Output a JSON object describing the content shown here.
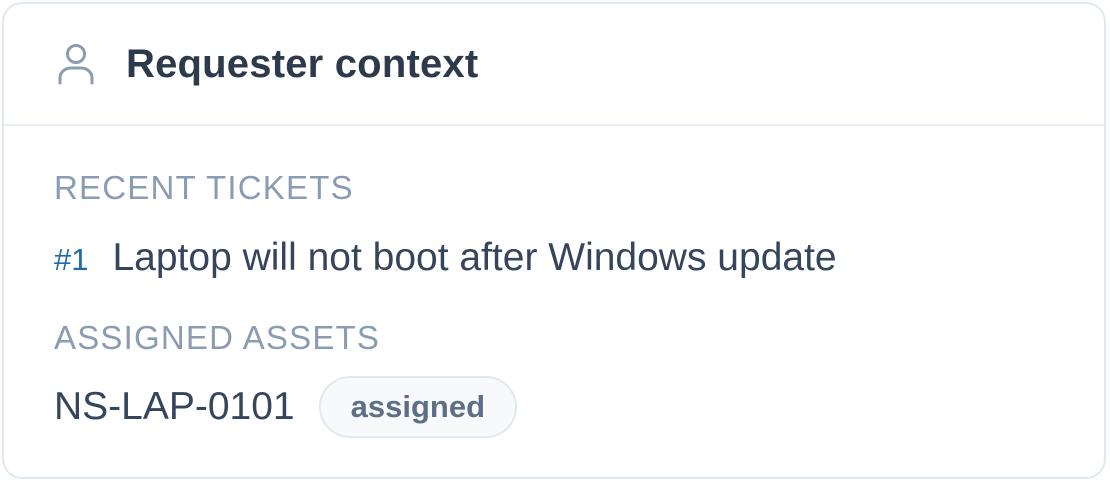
{
  "header": {
    "icon": "user-icon",
    "title": "Requester context"
  },
  "recent_tickets": {
    "label": "RECENT TICKETS",
    "items": [
      {
        "id": "#1",
        "title": "Laptop will not boot after Windows update"
      }
    ]
  },
  "assigned_assets": {
    "label": "ASSIGNED ASSETS",
    "items": [
      {
        "tag": "NS-LAP-0101",
        "status": "assigned"
      }
    ]
  },
  "colors": {
    "title": "#2d3a4b",
    "label": "#8b9bb2",
    "ticket_link": "#1e6ba8",
    "body_text": "#35465c",
    "border": "#e2e8f0"
  }
}
